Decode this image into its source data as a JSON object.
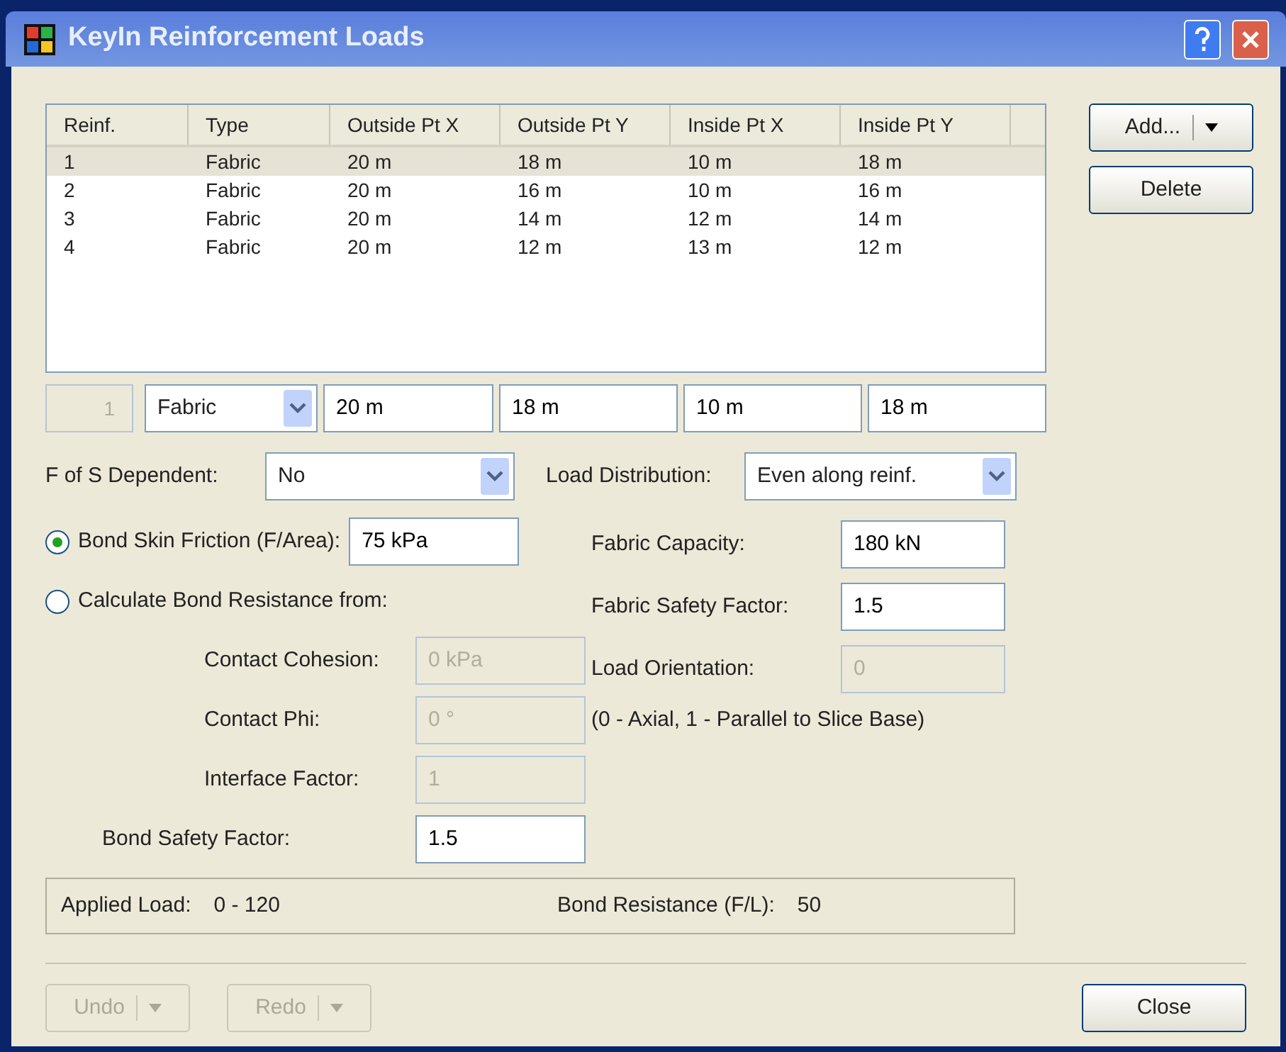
{
  "window": {
    "title": "KeyIn Reinforcement Loads"
  },
  "table": {
    "columns": [
      "Reinf.",
      "Type",
      "Outside Pt X",
      "Outside Pt Y",
      "Inside Pt X",
      "Inside Pt Y"
    ],
    "rows": [
      {
        "cells": [
          "1",
          "Fabric",
          "20 m",
          "18 m",
          "10 m",
          "18 m"
        ],
        "selected": true
      },
      {
        "cells": [
          "2",
          "Fabric",
          "20 m",
          "16 m",
          "10 m",
          "16 m"
        ],
        "selected": false
      },
      {
        "cells": [
          "3",
          "Fabric",
          "20 m",
          "14 m",
          "12 m",
          "14 m"
        ],
        "selected": false
      },
      {
        "cells": [
          "4",
          "Fabric",
          "20 m",
          "12 m",
          "13 m",
          "12 m"
        ],
        "selected": false
      }
    ]
  },
  "side_buttons": [
    {
      "label": "Add...",
      "kind": "split"
    },
    {
      "label": "Delete",
      "kind": "plain"
    }
  ],
  "edit_row": {
    "index": "1",
    "type": "Fabric",
    "values": [
      "20 m",
      "18 m",
      "10 m",
      "18 m"
    ]
  },
  "fos_dependent": {
    "label": "F of S Dependent:",
    "value": "No"
  },
  "load_distribution": {
    "label": "Load Distribution:",
    "value": "Even along reinf."
  },
  "bond_options": [
    {
      "label": "Bond Skin Friction (F/Area):",
      "value": "75 kPa",
      "selected": true
    },
    {
      "label": "Calculate Bond Resistance from:",
      "selected": false
    }
  ],
  "bond_fields": [
    {
      "label": "Contact Cohesion:",
      "value": "0 kPa",
      "disabled": true
    },
    {
      "label": "Contact Phi:",
      "value": "0 °",
      "disabled": true
    },
    {
      "label": "Interface Factor:",
      "value": "1",
      "disabled": true
    }
  ],
  "bond_safety": {
    "label": "Bond Safety Factor:",
    "value": "1.5",
    "disabled": false
  },
  "right_fields": [
    {
      "label": "Fabric Capacity:",
      "value": "180 kN",
      "disabled": false
    },
    {
      "label": "Fabric Safety Factor:",
      "value": "1.5",
      "disabled": false
    },
    {
      "label": "Load Orientation:",
      "value": "0",
      "disabled": true
    }
  ],
  "orientation_note": "(0 - Axial, 1 - Parallel to Slice Base)",
  "summary": [
    {
      "label": "Applied Load:",
      "value": "0 - 120"
    },
    {
      "label": "Bond Resistance (F/L):",
      "value": "50"
    }
  ],
  "footer_buttons": [
    {
      "label": "Undo",
      "disabled": true
    },
    {
      "label": "Redo",
      "disabled": true
    }
  ],
  "close_button": "Close"
}
